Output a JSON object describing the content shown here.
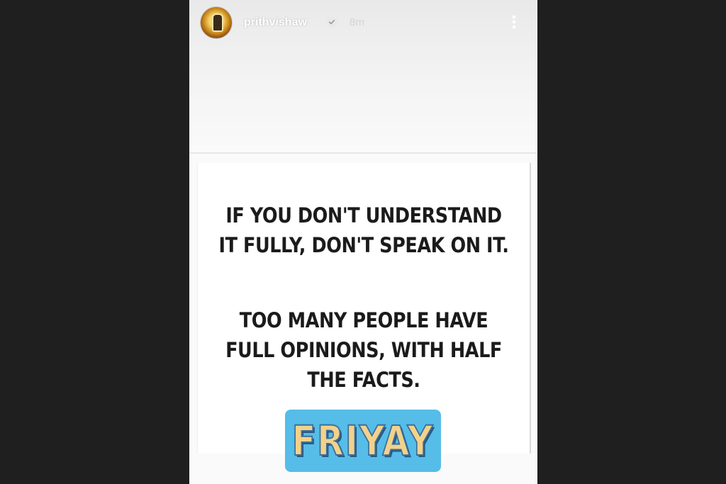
{
  "story": {
    "username": "prithvishaw",
    "verified": true,
    "time_ago": "8m",
    "quote_line_group_1": [
      "IF YOU DON'T UNDERSTAND",
      "IT FULLY, DON'T SPEAK ON IT."
    ],
    "quote_line_group_2": [
      "TOO MANY PEOPLE HAVE",
      "FULL OPINIONS, WITH HALF",
      "THE FACTS."
    ],
    "sticker_text": "FRIYAY"
  },
  "icons": {
    "verified": "verified-badge-icon",
    "more": "more-vertical-icon"
  },
  "colors": {
    "background": "#1f1f1f",
    "sticker": "#55bde8",
    "sticker_text": "#f2d28a"
  }
}
